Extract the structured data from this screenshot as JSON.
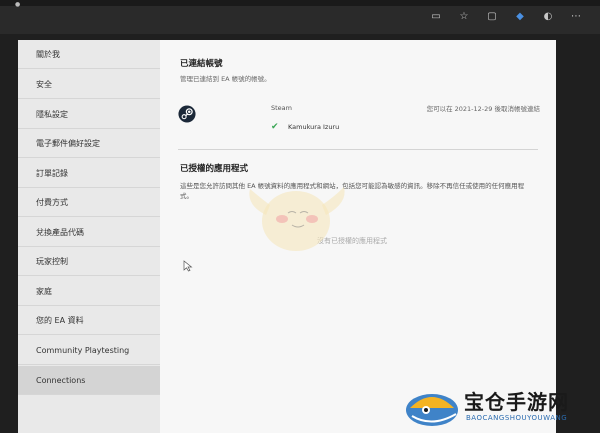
{
  "sidebar": {
    "items": [
      {
        "label": "關於我"
      },
      {
        "label": "安全"
      },
      {
        "label": "隱私設定"
      },
      {
        "label": "電子郵件偏好設定"
      },
      {
        "label": "訂單記錄"
      },
      {
        "label": "付費方式"
      },
      {
        "label": "兌換產品代碼"
      },
      {
        "label": "玩家控制"
      },
      {
        "label": "家庭"
      },
      {
        "label": "您的 EA 資料"
      },
      {
        "label": "Community Playtesting"
      },
      {
        "label": "Connections"
      }
    ],
    "active_index": 11
  },
  "linked_accounts": {
    "title": "已連結帳號",
    "subtitle": "管理已連結到 EA 帳號的帳號。",
    "items": [
      {
        "platform": "Steam",
        "icon": "steam-icon",
        "account_name": "Kamukura Izuru",
        "linked_text": "您可以在 2021-12-29 後取消帳號連結"
      }
    ]
  },
  "authorized_apps": {
    "title": "已授權的應用程式",
    "description": "這些是您允許訪問其他 EA 帳號資料的應用程式和網站，包括您可能認為敏感的資訊。移除不再信任或使用的任何應用程式。",
    "empty_message": "沒有已授權的應用程式"
  },
  "browser": {
    "icons": [
      "reader-icon",
      "favorite-icon",
      "collections-icon",
      "extension-icon",
      "profile-icon"
    ],
    "accent_color": "#4a90e2"
  },
  "watermark": {
    "title": "宝仓手游网",
    "url": "BAOCANGSHOUYOUWANG"
  }
}
